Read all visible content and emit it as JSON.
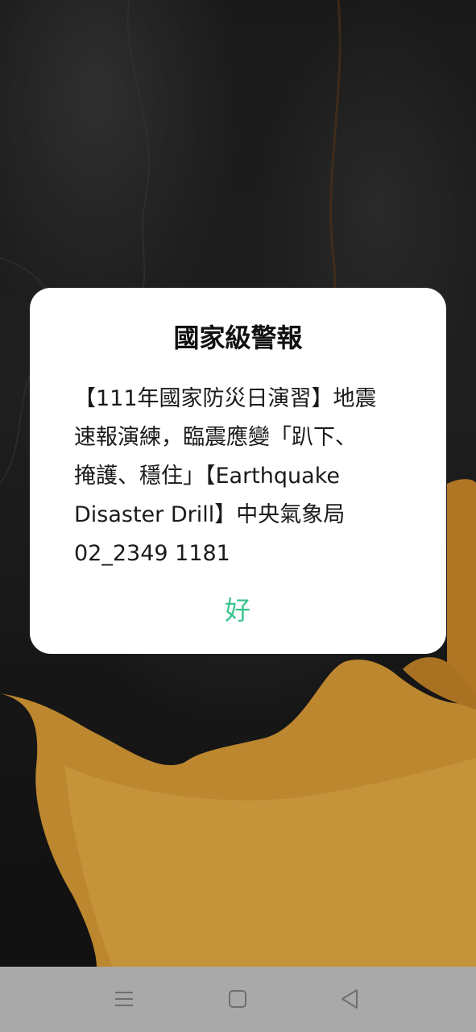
{
  "alert": {
    "title": "國家級警報",
    "message": "【111年國家防災日演習】地震\n速報演練，臨震應變「趴下、\n掩護、穩住」【Earthquake\nDisaster Drill】中央氣象局\n02_2349 1181",
    "ok_label": "好"
  },
  "colors": {
    "accent": "#38c48e",
    "navbar": "#a9a9a9",
    "wallpaper_orange": "#e6a53a"
  },
  "navbar": {
    "buttons": [
      "menu-icon",
      "home-icon",
      "back-icon"
    ]
  }
}
